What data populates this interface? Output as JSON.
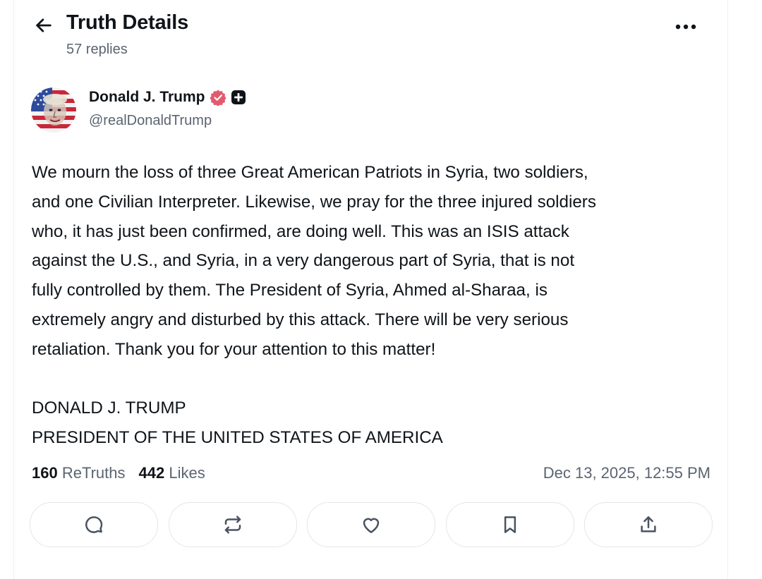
{
  "header": {
    "title": "Truth Details",
    "replies": "57 replies",
    "back_icon": "arrow-left-icon",
    "more_icon": "ellipsis-icon"
  },
  "author": {
    "name": "Donald J. Trump",
    "handle": "@realDonaldTrump",
    "verified_color": "#e35a6f",
    "badge_icon": "plus-badge-icon"
  },
  "post": {
    "lines": [
      "We mourn the loss of three Great American Patriots in Syria, two soldiers,",
      "and one Civilian Interpreter. Likewise, we pray for the three injured soldiers",
      "who, it has just been confirmed, are doing well. This was an ISIS attack",
      "against the U.S., and Syria, in a very dangerous part of Syria, that is not",
      "fully controlled by them. The President of Syria, Ahmed al-Sharaa, is",
      "extremely angry and disturbed by this attack. There will be very serious",
      "retaliation. Thank you for your attention to this matter!"
    ],
    "signature": [
      "DONALD J. TRUMP",
      "PRESIDENT OF THE UNITED STATES OF AMERICA"
    ]
  },
  "stats": {
    "retruths_count": "160",
    "retruths_label": "ReTruths",
    "likes_count": "442",
    "likes_label": "Likes",
    "timestamp": "Dec 13, 2025, 12:55 PM"
  },
  "actions": [
    {
      "name": "reply",
      "icon": "comment-icon"
    },
    {
      "name": "retruth",
      "icon": "repost-icon"
    },
    {
      "name": "like",
      "icon": "heart-icon"
    },
    {
      "name": "bookmark",
      "icon": "bookmark-icon"
    },
    {
      "name": "share",
      "icon": "share-icon"
    }
  ],
  "colors": {
    "text": "#0f1419",
    "muted": "#5b6470",
    "border": "#e3e6ea"
  }
}
